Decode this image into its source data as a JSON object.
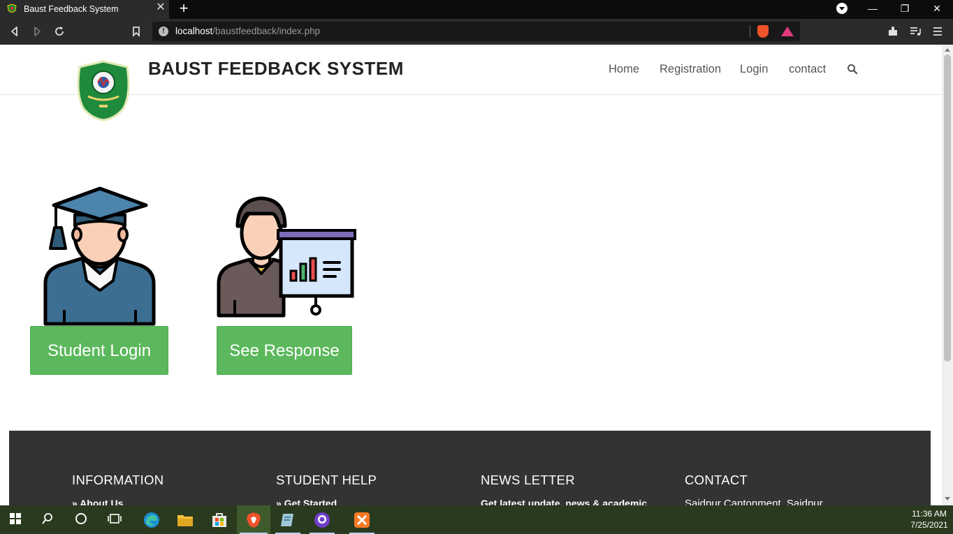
{
  "browser": {
    "tab_title": "Baust Feedback System",
    "tab_close": "✕",
    "new_tab": "+",
    "url_host": "localhost",
    "url_path": "/baustfeedback/index.php",
    "window_minimize": "—",
    "window_restore": "❐",
    "window_close": "✕"
  },
  "site": {
    "title": "BAUST FEEDBACK SYSTEM",
    "nav": [
      "Home",
      "Registration",
      "Login",
      "contact"
    ]
  },
  "main": {
    "student_login": "Student Login",
    "see_response": "See Response"
  },
  "footer": {
    "columns": [
      {
        "heading": "INFORMATION",
        "line": "»  About Us"
      },
      {
        "heading": "STUDENT HELP",
        "line": "»  Get Started"
      },
      {
        "heading": "NEWS LETTER",
        "line": "Get latest update, news & academic"
      },
      {
        "heading": "CONTACT",
        "line": "Saidpur Cantonment, Saidpur"
      }
    ]
  },
  "taskbar": {
    "time": "11:36 AM",
    "date": "7/25/2021"
  },
  "colors": {
    "button_green": "#5cb85c",
    "footer_bg": "#333333",
    "browser_dark": "#2b2b2e"
  }
}
